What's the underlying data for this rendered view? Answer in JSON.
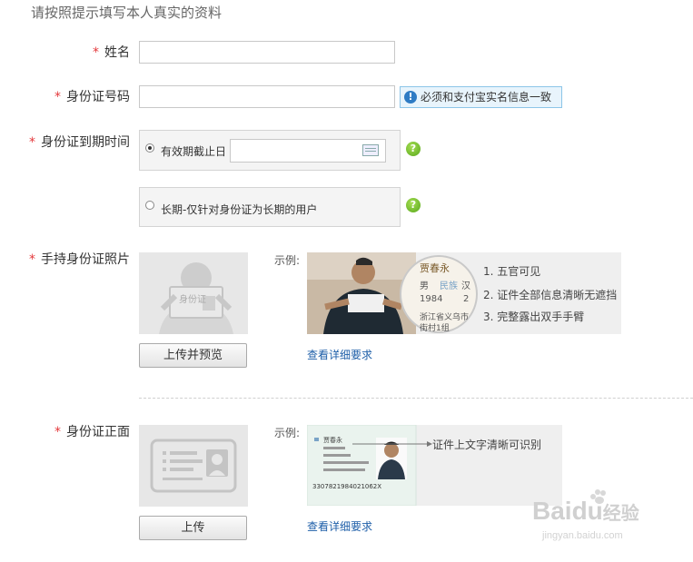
{
  "title": "请按照提示填写本人真实的资料",
  "star": "*",
  "name": {
    "label": "姓名",
    "value": ""
  },
  "idnum": {
    "label": "身份证号码",
    "value": "",
    "notice": "必须和支付宝实名信息一致",
    "notice_icon": "!"
  },
  "expiry": {
    "label": "身份证到期时间",
    "option1": "有效期截止日",
    "option2": "长期-仅针对身份证为长期的用户",
    "date_value": "",
    "help": "?"
  },
  "holding_photo": {
    "label": "手持身份证照片",
    "placeholder_text": "身份证",
    "upload_button": "上传并预览",
    "sample_label": "示例:",
    "card_name": "贾春永",
    "card_sex": "男",
    "card_nation_label": "民族",
    "card_nation": "汉",
    "card_year": "1984",
    "card_month": "2",
    "card_addr1": "浙江省义乌市",
    "card_addr2": "街村1组",
    "requirements": [
      "1. 五官可见",
      "2. 证件全部信息清晰无遮挡",
      "3. 完整露出双手手臂"
    ],
    "detail_link": "查看详细要求"
  },
  "front": {
    "label": "身份证正面",
    "upload_button": "上传",
    "sample_label": "示例:",
    "card_name": "贾春永",
    "card_number": "3307821984021062X",
    "annotation": "证件上文字清晰可识别",
    "detail_link": "查看详细要求"
  },
  "watermark": {
    "brand": "Baidu",
    "cn": "经验",
    "url": "jingyan.baidu.com"
  },
  "colors": {
    "accent": "#1d5ea8",
    "required": "#e4393c",
    "help": "#6bbf2a"
  }
}
